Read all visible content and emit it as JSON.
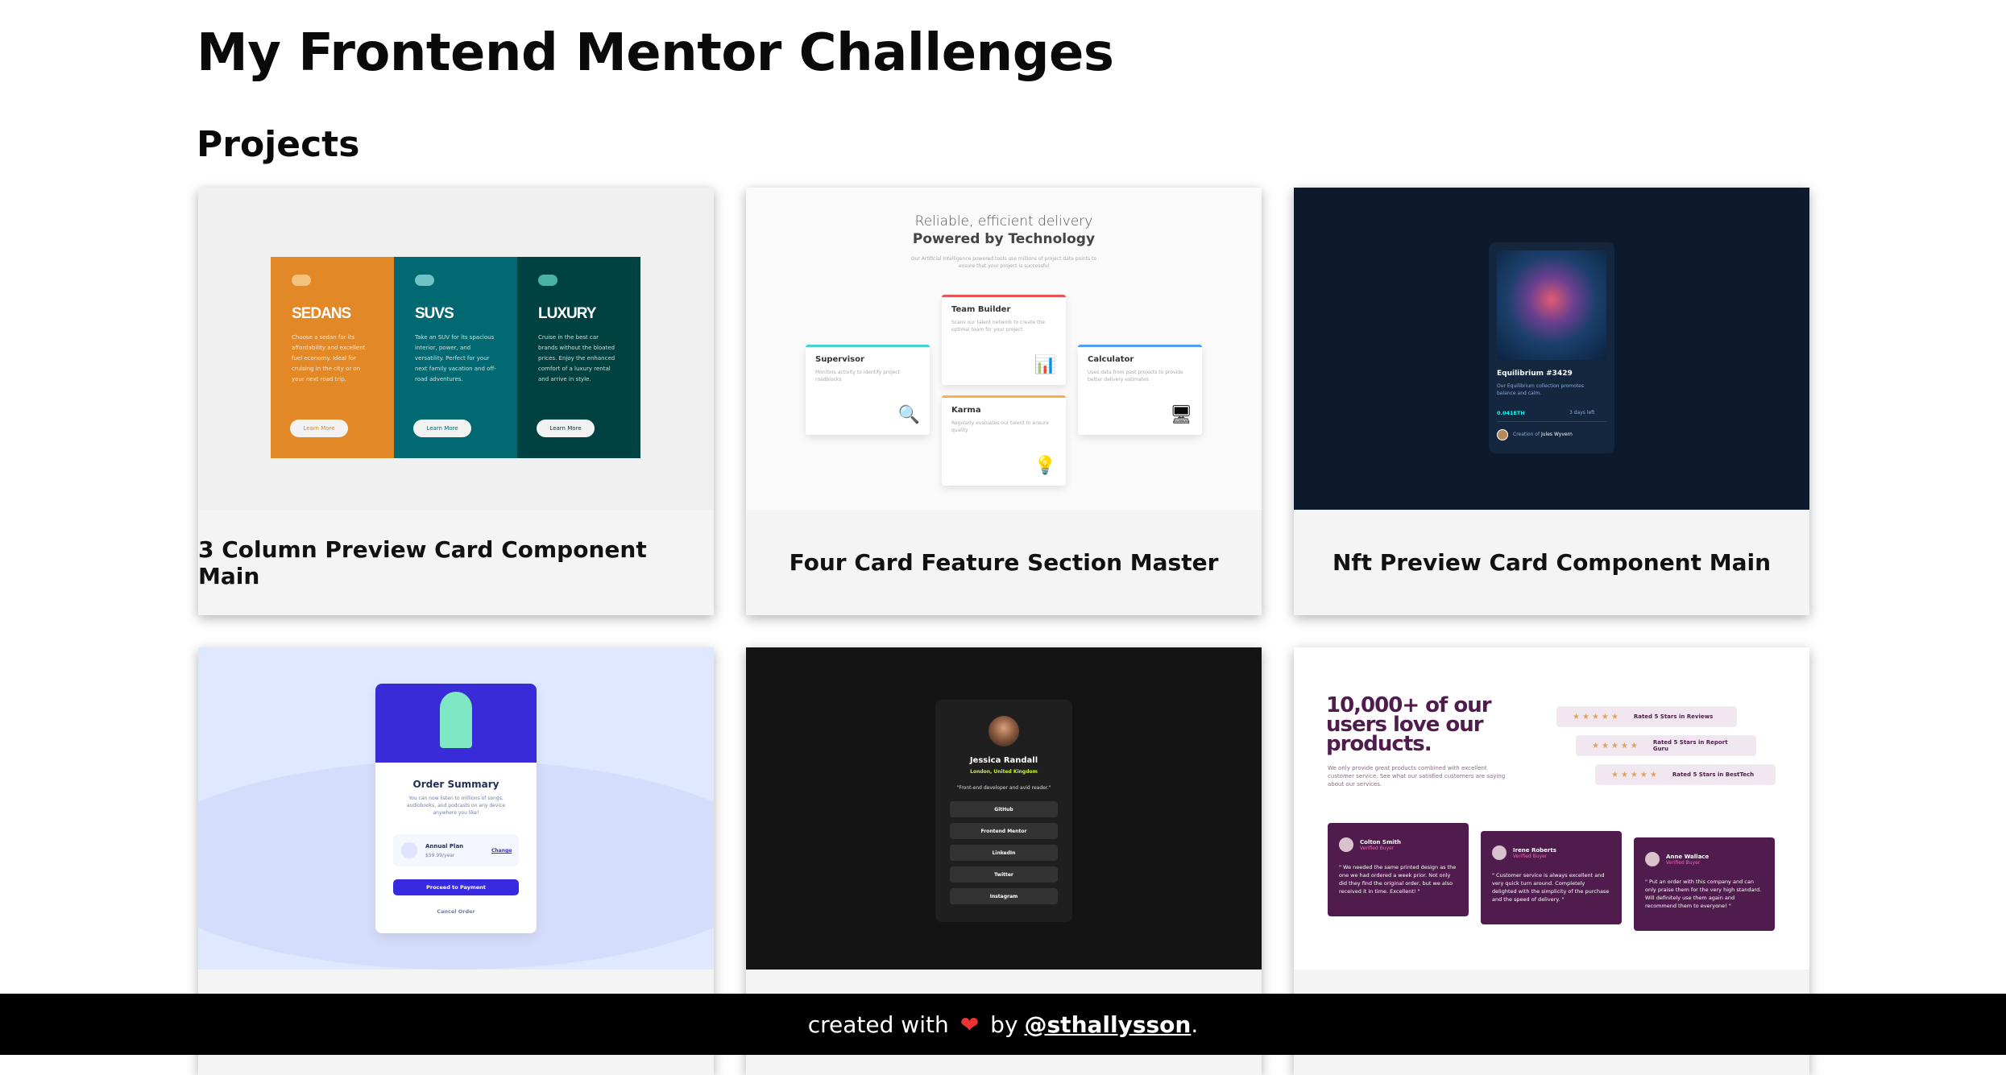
{
  "page": {
    "title": "My Frontend Mentor Challenges"
  },
  "projects": {
    "heading": "Projects",
    "items": [
      {
        "title": "3 Column Preview Card Component Main",
        "preview": {
          "columns": [
            {
              "title": "SEDANS",
              "text": "Choose a sedan for its affordability and excellent fuel economy. Ideal for cruising in the city or on your next road trip.",
              "button": "Learn More",
              "color": "#e38826"
            },
            {
              "title": "SUVS",
              "text": "Take an SUV for its spacious interior, power, and versatility. Perfect for your next family vacation and off-road adventures.",
              "button": "Learn More",
              "color": "#006971"
            },
            {
              "title": "LUXURY",
              "text": "Cruise in the best car brands without the bloated prices. Enjoy the enhanced comfort of a luxury rental and arrive in style.",
              "button": "Learn More",
              "color": "#004241"
            }
          ]
        }
      },
      {
        "title": "Four Card Feature Section Master",
        "preview": {
          "line1": "Reliable, efficient delivery",
          "line2": "Powered by Technology",
          "intro": "Our Artificial Intelligence powered tools use millions of project data points to ensure that your project is successful",
          "cards": [
            {
              "name": "Supervisor",
              "text": "Monitors activity to identify project roadblocks",
              "icon": "magnifier-icon",
              "color": "#44d3d2"
            },
            {
              "name": "Team Builder",
              "text": "Scans our talent network to create the optimal team for your project",
              "icon": "chart-icon",
              "color": "#ea5454"
            },
            {
              "name": "Karma",
              "text": "Regularly evaluates our talent to ensure quality",
              "icon": "lightbulb-icon",
              "color": "#fcae4a"
            },
            {
              "name": "Calculator",
              "text": "Uses data from past projects to provide better delivery estimates",
              "icon": "monitor-icon",
              "color": "#549ef2"
            }
          ]
        }
      },
      {
        "title": "Nft Preview Card Component Main",
        "preview": {
          "name": "Equilibrium #3429",
          "desc": "Our Equilibrium collection promotes balance and calm.",
          "price": "0.041ETH",
          "time": "3 days left",
          "creator_prefix": "Creation of",
          "creator": "Jules Wyvern"
        }
      },
      {
        "title": "",
        "preview": {
          "heading": "Order Summary",
          "text": "You can now listen to millions of songs, audiobooks, and podcasts on any device anywhere you like!",
          "plan": "Annual Plan",
          "price": "$59.99/year",
          "change": "Change",
          "pay": "Proceed to Payment",
          "cancel": "Cancel Order"
        }
      },
      {
        "title": "",
        "preview": {
          "name": "Jessica Randall",
          "location": "London, United Kingdom",
          "bio": "\"Front-end developer and avid reader.\"",
          "links": [
            "GitHub",
            "Frontend Mentor",
            "LinkedIn",
            "Twitter",
            "Instagram"
          ]
        }
      },
      {
        "title": "",
        "preview": {
          "heading": "10,000+ of our users love our products.",
          "text": "We only provide great products combined with excellent customer service. See what our satisfied customers are saying about our services.",
          "ratings": [
            "Rated 5 Stars in Reviews",
            "Rated 5 Stars in Report Guru",
            "Rated 5 Stars in BestTech"
          ],
          "testimonials": [
            {
              "name": "Colton Smith",
              "badge": "Verified Buyer",
              "quote": "\" We needed the same printed design as the one we had ordered a week prior. Not only did they find the original order, but we also received it in time. Excellent! \""
            },
            {
              "name": "Irene Roberts",
              "badge": "Verified Buyer",
              "quote": "\" Customer service is always excellent and very quick turn around. Completely delighted with the simplicity of the purchase and the speed of delivery. \""
            },
            {
              "name": "Anne Wallace",
              "badge": "Verified Buyer",
              "quote": "\" Put an order with this company and can only praise them for the very high standard. Will definitely use them again and recommend them to everyone! \""
            }
          ]
        }
      }
    ]
  },
  "footer": {
    "prefix": "created with",
    "heart_icon": "heart-icon",
    "by": "by",
    "author": "@sthallysson",
    "suffix": "."
  }
}
